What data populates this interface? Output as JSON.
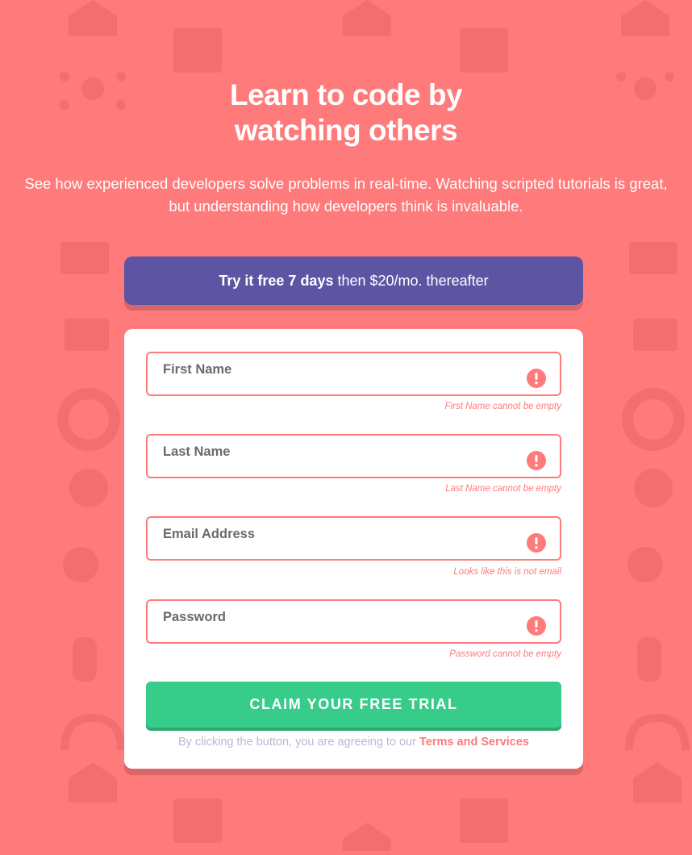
{
  "hero": {
    "title_line1": "Learn to code by",
    "title_line2": "watching others",
    "subtitle": "See how experienced developers solve problems in real-time. Watching scripted tutorials is great, but understanding how developers think is invaluable."
  },
  "promo": {
    "bold": "Try it free 7 days",
    "rest": "then $20/mo. thereafter"
  },
  "form": {
    "fields": [
      {
        "name": "first-name",
        "placeholder": "First Name",
        "value": "",
        "error": "First Name cannot be empty"
      },
      {
        "name": "last-name",
        "placeholder": "Last Name",
        "value": "",
        "error": "Last Name cannot be empty"
      },
      {
        "name": "email",
        "placeholder": "Email Address",
        "value": "",
        "error": "Looks like this is not email"
      },
      {
        "name": "password",
        "placeholder": "Password",
        "value": "",
        "error": "Password cannot be empty"
      }
    ],
    "submit_label": "CLAIM YOUR FREE TRIAL",
    "legal_text": "By clicking the button, you are agreeing to our",
    "legal_link": "Terms and Services"
  },
  "colors": {
    "background": "#ff7a7a",
    "promo": "#5e54a4",
    "accent_green": "#38cc8b",
    "error": "#ff7a7a",
    "muted": "#bab7d4"
  },
  "icons": {
    "field_error": "error-circle-icon"
  }
}
